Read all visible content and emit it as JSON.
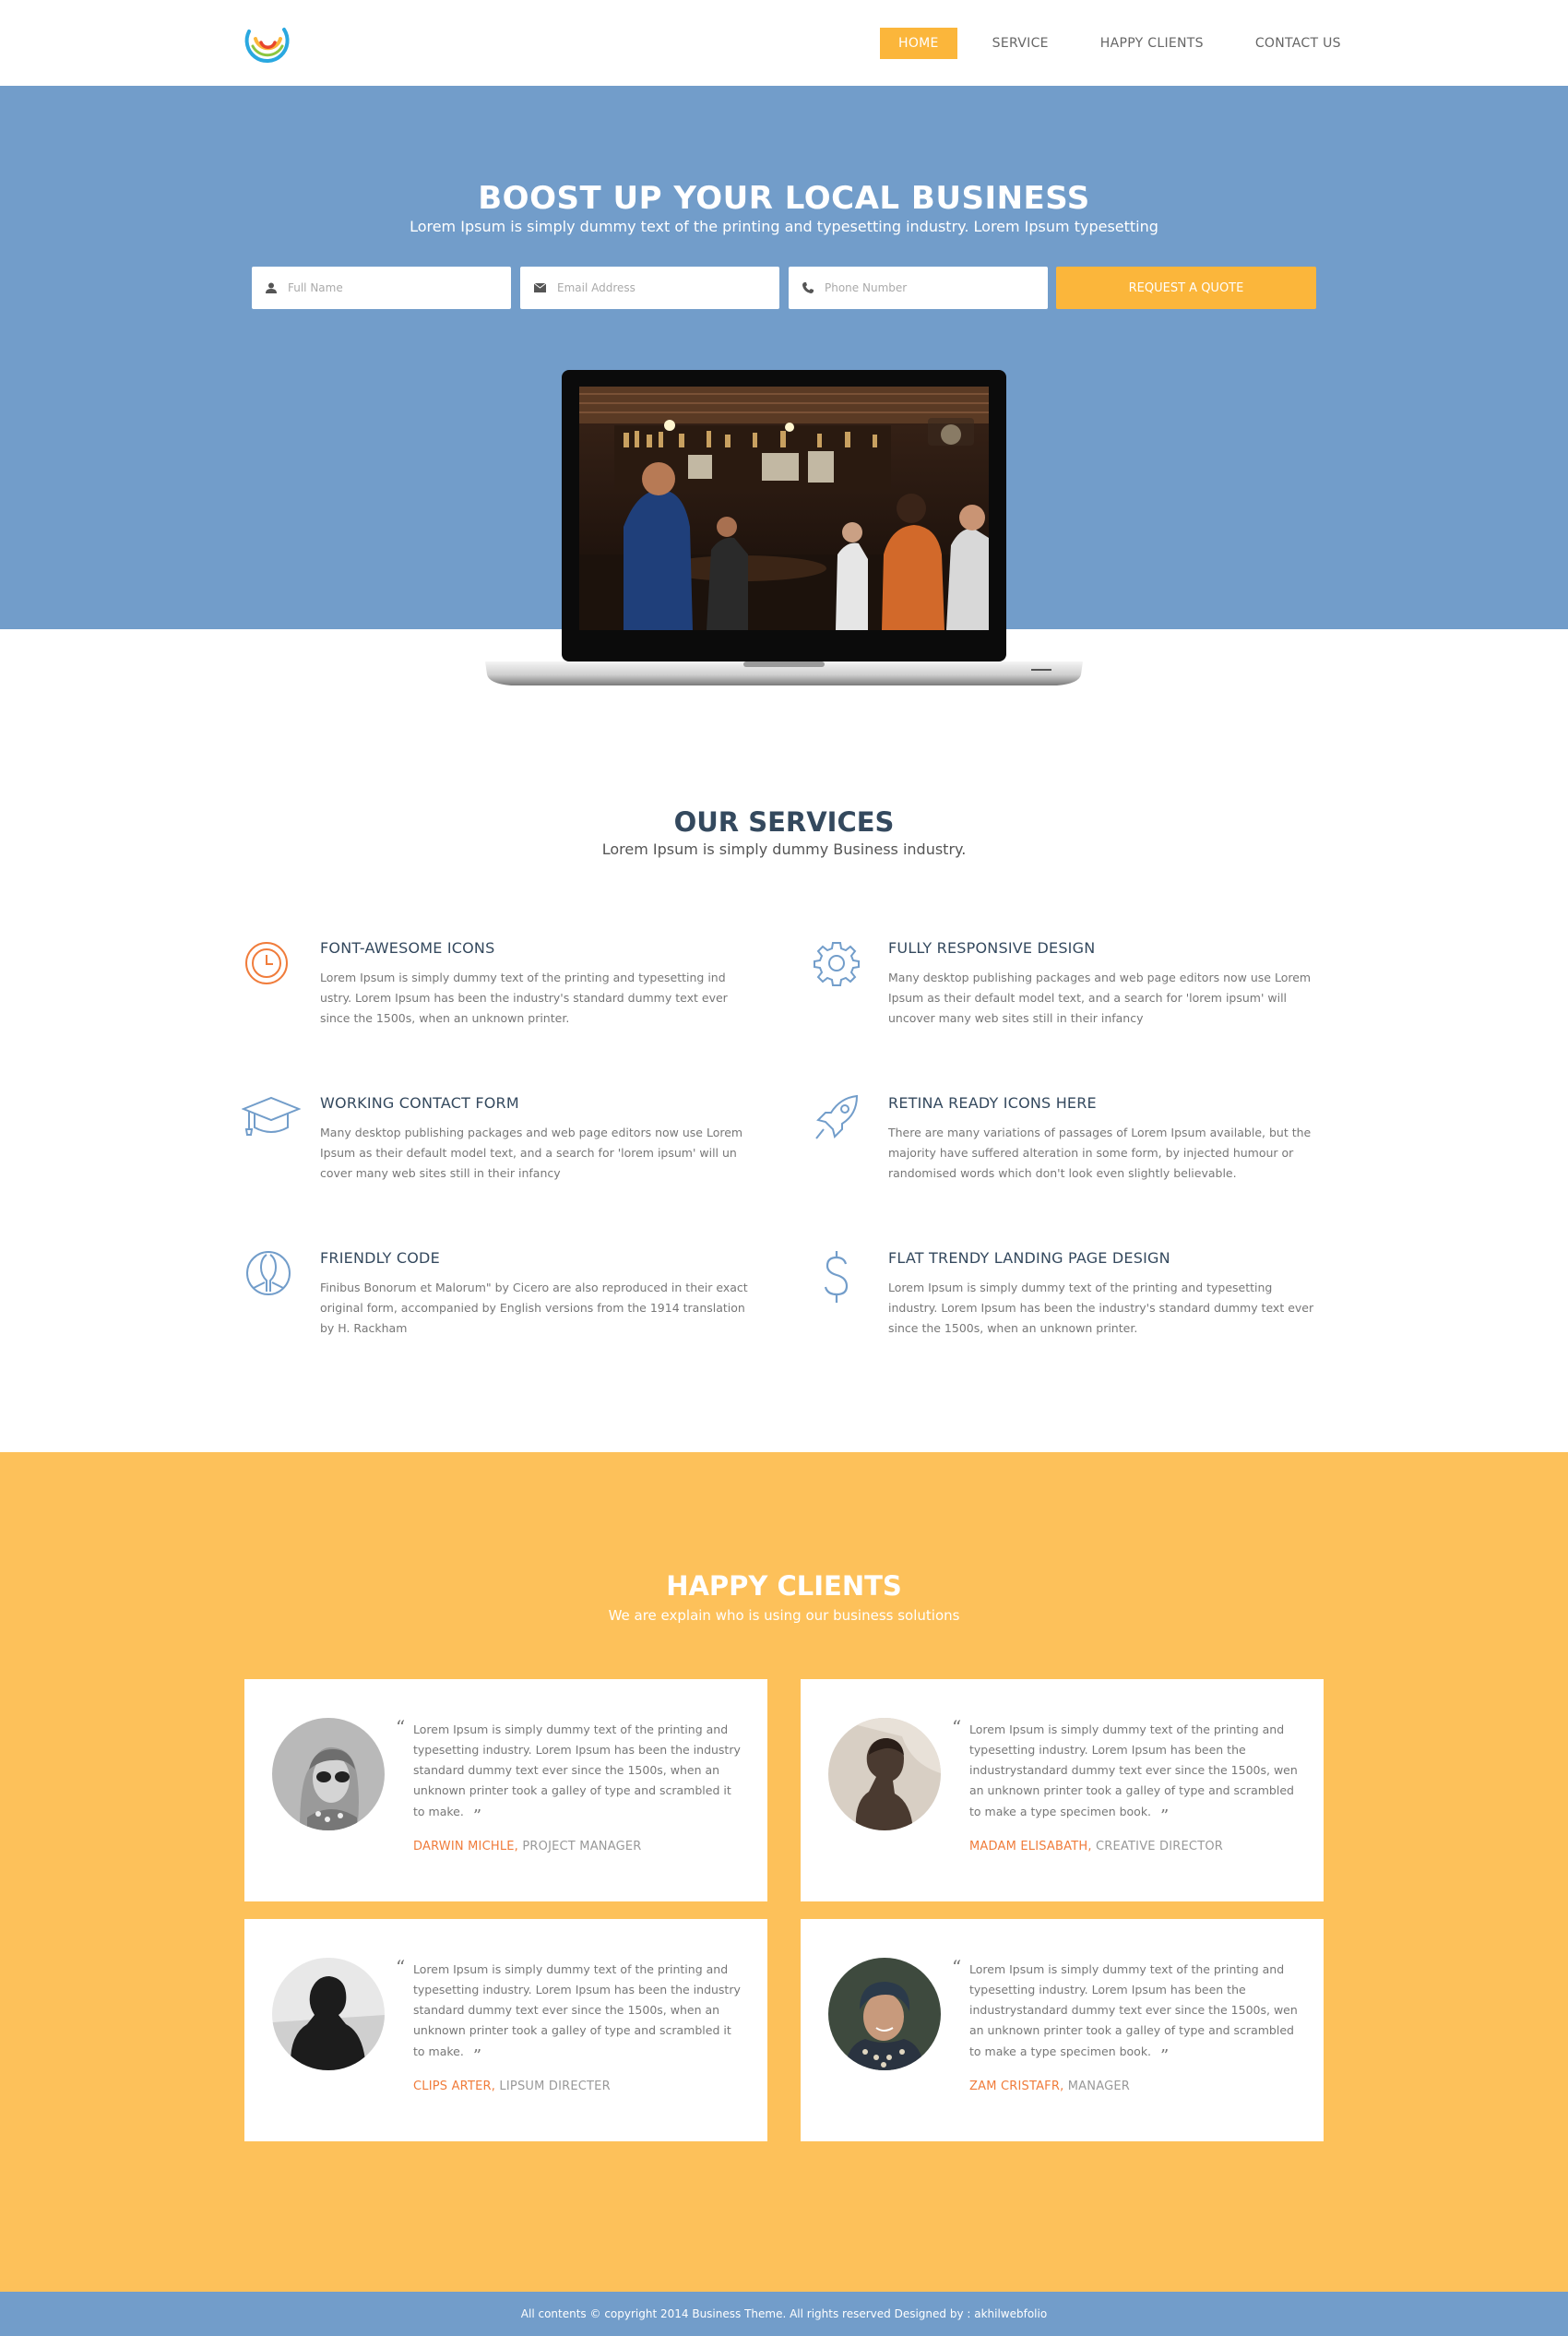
{
  "nav": {
    "items": [
      {
        "label": "HOME",
        "active": true
      },
      {
        "label": "SERVICE",
        "active": false
      },
      {
        "label": "HAPPY CLIENTS",
        "active": false
      },
      {
        "label": "CONTACT US",
        "active": false
      }
    ]
  },
  "hero": {
    "title": "BOOST UP YOUR LOCAL BUSINESS",
    "subtitle": "Lorem Ipsum is simply dummy text of the printing and typesetting industry. Lorem Ipsum typesetting",
    "form": {
      "name_placeholder": "Full Name",
      "email_placeholder": "Email Address",
      "phone_placeholder": "Phone Number",
      "submit_label": "REQUEST A QUOTE"
    }
  },
  "services": {
    "title": "OUR SERVICES",
    "subtitle": "Lorem Ipsum is simply dummy Business industry.",
    "items": [
      {
        "icon": "clock-icon",
        "title": "FONT-AWESOME ICONS",
        "text": "Lorem Ipsum is simply dummy text of the printing and typesetting ind ustry. Lorem Ipsum has been the industry's standard dummy text ever since the 1500s, when an unknown printer."
      },
      {
        "icon": "gear-icon",
        "title": "FULLY RESPONSIVE DESIGN",
        "text": "Many desktop publishing packages and web page editors now use Lorem Ipsum as their default model text, and a search for 'lorem ipsum' will uncover many web sites still in their infancy"
      },
      {
        "icon": "graduation-cap-icon",
        "title": "WORKING CONTACT FORM",
        "text": "Many desktop publishing packages and web page editors now use Lorem Ipsum as their default model text, and a search for 'lorem ipsum' will un cover many web sites still in their infancy"
      },
      {
        "icon": "rocket-icon",
        "title": "RETINA READY ICONS HERE",
        "text": "There are many variations of passages of Lorem Ipsum available, but the majority have suffered alteration in some form, by injected humour or randomised words which don't look even slightly believable."
      },
      {
        "icon": "peace-icon",
        "title": "FRIENDLY CODE",
        "text": "Finibus Bonorum et Malorum\" by Cicero are also reproduced in their exact original form, accompanied by English versions from the 1914 translation by H. Rackham"
      },
      {
        "icon": "dollar-icon",
        "title": "FLAT TRENDY LANDING PAGE DESIGN",
        "text": "Lorem Ipsum is simply dummy text of the printing and typesetting industry. Lorem Ipsum has been the industry's standard dummy text ever since the 1500s, when an unknown printer."
      }
    ]
  },
  "clients": {
    "title": "HAPPY CLIENTS",
    "subtitle": "We are explain who is using our business solutions",
    "testimonials": [
      {
        "text": "Lorem Ipsum is simply dummy text of the printing and typesetting industry. Lorem Ipsum has been the industry standard dummy text ever since the 1500s, when an unknown printer took a galley of type and scrambled it to make.",
        "name": "DARWIN MICHLE,",
        "role": "PROJECT MANAGER"
      },
      {
        "text": "Lorem Ipsum is simply dummy text of the printing and typesetting industry. Lorem Ipsum has been the industrystandard dummy text ever since the 1500s, wen an unknown printer took a galley of type and scrambled to make a type specimen book.",
        "name": "MADAM ELISABATH,",
        "role": "CREATIVE DIRECTOR"
      },
      {
        "text": "Lorem Ipsum is simply dummy text of the printing and typesetting industry. Lorem Ipsum has been the industry standard dummy text ever since the 1500s, when an unknown printer took a galley of type and scrambled it to make.",
        "name": "CLIPS ARTER,",
        "role": "LIPSUM DIRECTER"
      },
      {
        "text": "Lorem Ipsum is simply dummy text of the printing and typesetting industry. Lorem Ipsum has been the industrystandard dummy text ever since the 1500s, wen an unknown printer took a galley of type and scrambled to make a type specimen book.",
        "name": "ZAM CRISTAFR,",
        "role": "MANAGER"
      }
    ]
  },
  "footer": {
    "text": "All contents © copyright 2014 Business Theme. All rights reserved Designed by : akhilwebfolio"
  },
  "colors": {
    "primary_blue": "#729dca",
    "accent_yellow": "#fbb63b",
    "clients_bg": "#fdc15a",
    "heading_dark": "#34495e",
    "author_orange": "#f07c3b"
  }
}
